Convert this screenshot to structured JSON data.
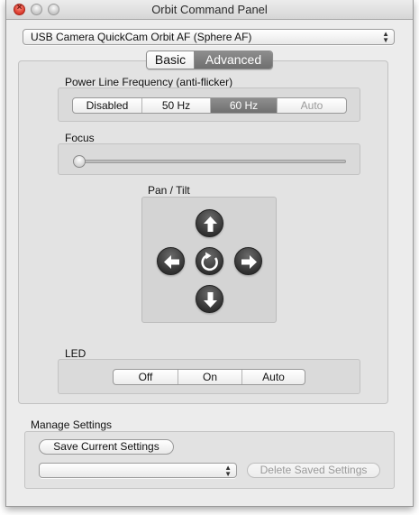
{
  "window": {
    "title": "Orbit Command Panel",
    "close_glyph": "×"
  },
  "device": {
    "selected": "USB Camera QuickCam Orbit AF (Sphere AF)"
  },
  "tabs": [
    {
      "label": "Basic",
      "selected": false
    },
    {
      "label": "Advanced",
      "selected": true
    }
  ],
  "power_line": {
    "label": "Power Line Frequency (anti-flicker)",
    "options": [
      {
        "label": "Disabled",
        "selected": false,
        "enabled": true
      },
      {
        "label": "50 Hz",
        "selected": false,
        "enabled": true
      },
      {
        "label": "60 Hz",
        "selected": true,
        "enabled": true
      },
      {
        "label": "Auto",
        "selected": false,
        "enabled": false
      }
    ]
  },
  "focus": {
    "label": "Focus",
    "value_fraction": 0.0
  },
  "pan_tilt": {
    "label": "Pan / Tilt",
    "buttons": [
      "up-arrow-icon",
      "left-arrow-icon",
      "reset-icon",
      "right-arrow-icon",
      "down-arrow-icon"
    ]
  },
  "led": {
    "label": "LED",
    "options": [
      {
        "label": "Off",
        "selected": false
      },
      {
        "label": "On",
        "selected": false
      },
      {
        "label": "Auto",
        "selected": false
      }
    ]
  },
  "manage": {
    "label": "Manage Settings",
    "save_button": "Save Current Settings",
    "saved_select_value": "",
    "delete_button": "Delete Saved Settings"
  },
  "colors": {
    "window_bg": "#ececec",
    "selected_segment": "#7a7a7a",
    "close_red": "#d8392b"
  }
}
